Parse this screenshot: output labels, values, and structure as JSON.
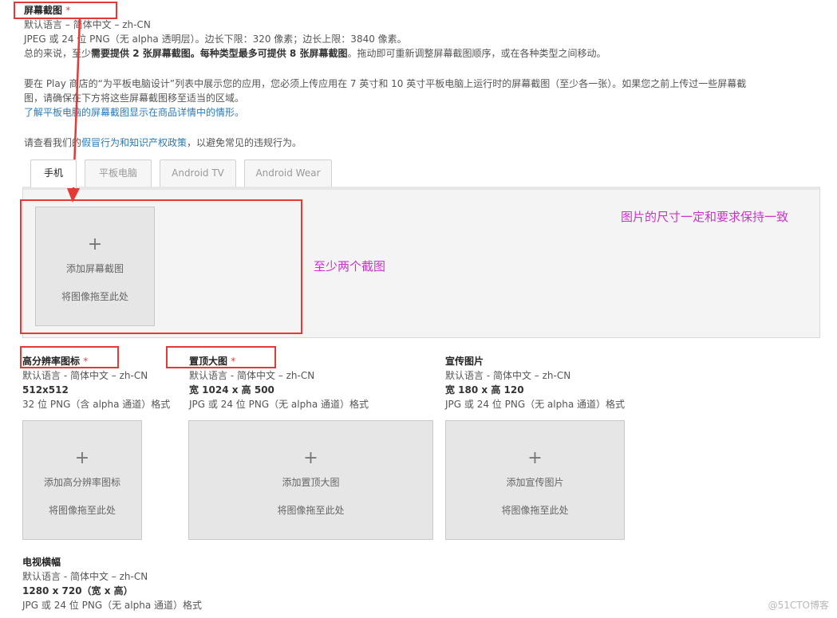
{
  "screenshots": {
    "title": "屏幕截图",
    "required_mark": "*",
    "lang_line": "默认语言 – 简体中文 – zh-CN",
    "format_line": "JPEG 或 24 位 PNG（无 alpha 透明层）。边长下限：320 像素；边长上限：3840 像素。",
    "summary_prefix": "总的来说，至少",
    "summary_bold1": "需要提供 2 张屏幕截图。",
    "summary_bold2": "每种类型最多可提供 8 张屏幕截图",
    "summary_suffix": "。拖动即可重新调整屏幕截图顺序，或在各种类型之间移动。",
    "tablet_line1": "要在 Play 商店的“为平板电脑设计”列表中展示您的应用，您必须上传应用在 7 英寸和 10 英寸平板电脑上运行时的屏幕截图（至少各一张）。如果您之前上传过一些屏幕截",
    "tablet_line2": "图，请确保在下方将这些屏幕截图移至适当的区域。",
    "tablet_link": "了解平板电脑的屏幕截图显示在商品详情中的情形。",
    "policy_prefix": "请查看我们的",
    "policy_link": "假冒行为和知识产权政策",
    "policy_suffix": "，以避免常见的违规行为。",
    "tabs": [
      "手机",
      "平板电脑",
      "Android TV",
      "Android Wear"
    ],
    "add_label": "添加屏幕截图",
    "drag_label": "将图像拖至此处"
  },
  "annotations": {
    "size_note": "图片的尺寸一定和要求保持一致",
    "min_note": "至少两个截图",
    "color": "#cc33cc",
    "box_color": "#e53935"
  },
  "hires_icon": {
    "title": "高分辨率图标",
    "required_mark": "*",
    "lang_line": "默认语言 - 简体中文 – zh-CN",
    "size_line": "512x512",
    "format_line": "32 位 PNG（含 alpha 通道）格式",
    "add_label": "添加高分辨率图标",
    "drag_label": "将图像拖至此处"
  },
  "feature_graphic": {
    "title": "置顶大图",
    "required_mark": "*",
    "lang_line": "默认语言 - 简体中文 – zh-CN",
    "size_line": "宽 1024 x 高 500",
    "format_line": "JPG 或 24 位 PNG（无 alpha 通道）格式",
    "add_label": "添加置顶大图",
    "drag_label": "将图像拖至此处"
  },
  "promo_graphic": {
    "title": "宣传图片",
    "lang_line": "默认语言 - 简体中文 – zh-CN",
    "size_line": "宽 180 x 高 120",
    "format_line": "JPG 或 24 位 PNG（无 alpha 通道）格式",
    "add_label": "添加宣传图片",
    "drag_label": "将图像拖至此处"
  },
  "tv_banner": {
    "title": "电视横幅",
    "lang_line": "默认语言 - 简体中文 – zh-CN",
    "size_line": "1280 x 720（宽 x 高）",
    "format_line": "JPG 或 24 位 PNG（无 alpha 通道）格式"
  },
  "plus_glyph": "+",
  "watermark": "@51CTO博客"
}
